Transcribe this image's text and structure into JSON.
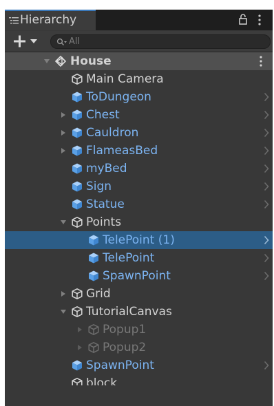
{
  "window": {
    "tab_label": "Hierarchy",
    "search_placeholder": "All"
  },
  "scene": {
    "name": "House"
  },
  "rows": [
    {
      "label": "Main Camera",
      "depth": 1,
      "type": "object",
      "fold": "none",
      "go_arrow": false,
      "selected": false,
      "disabled": false
    },
    {
      "label": "ToDungeon",
      "depth": 1,
      "type": "prefab",
      "fold": "none",
      "go_arrow": true,
      "selected": false,
      "disabled": false
    },
    {
      "label": "Chest",
      "depth": 1,
      "type": "prefab",
      "fold": "collapsed",
      "go_arrow": true,
      "selected": false,
      "disabled": false
    },
    {
      "label": "Cauldron",
      "depth": 1,
      "type": "prefab",
      "fold": "collapsed",
      "go_arrow": true,
      "selected": false,
      "disabled": false
    },
    {
      "label": "FlameasBed",
      "depth": 1,
      "type": "prefab",
      "fold": "collapsed",
      "go_arrow": true,
      "selected": false,
      "disabled": false
    },
    {
      "label": "myBed",
      "depth": 1,
      "type": "prefab",
      "fold": "none",
      "go_arrow": true,
      "selected": false,
      "disabled": false
    },
    {
      "label": "Sign",
      "depth": 1,
      "type": "prefab",
      "fold": "none",
      "go_arrow": true,
      "selected": false,
      "disabled": false
    },
    {
      "label": "Statue",
      "depth": 1,
      "type": "prefab",
      "fold": "none",
      "go_arrow": true,
      "selected": false,
      "disabled": false
    },
    {
      "label": "Points",
      "depth": 1,
      "type": "object",
      "fold": "expanded",
      "go_arrow": false,
      "selected": false,
      "disabled": false
    },
    {
      "label": "TelePoint (1)",
      "depth": 2,
      "type": "prefab",
      "fold": "none",
      "go_arrow": true,
      "selected": true,
      "disabled": false
    },
    {
      "label": "TelePoint",
      "depth": 2,
      "type": "prefab",
      "fold": "none",
      "go_arrow": true,
      "selected": false,
      "disabled": false
    },
    {
      "label": "SpawnPoint",
      "depth": 2,
      "type": "prefab",
      "fold": "none",
      "go_arrow": true,
      "selected": false,
      "disabled": false
    },
    {
      "label": "Grid",
      "depth": 1,
      "type": "object",
      "fold": "collapsed",
      "go_arrow": false,
      "selected": false,
      "disabled": false
    },
    {
      "label": "TutorialCanvas",
      "depth": 1,
      "type": "object",
      "fold": "expanded",
      "go_arrow": false,
      "selected": false,
      "disabled": false
    },
    {
      "label": "Popup1",
      "depth": 2,
      "type": "object",
      "fold": "collapsed",
      "go_arrow": false,
      "selected": false,
      "disabled": true
    },
    {
      "label": "Popup2",
      "depth": 2,
      "type": "object",
      "fold": "collapsed",
      "go_arrow": false,
      "selected": false,
      "disabled": true
    },
    {
      "label": "SpawnPoint",
      "depth": 1,
      "type": "prefab",
      "fold": "none",
      "go_arrow": true,
      "selected": false,
      "disabled": false
    },
    {
      "label": "block",
      "depth": 1,
      "type": "object",
      "fold": "none",
      "go_arrow": false,
      "selected": false,
      "disabled": false
    }
  ],
  "colors": {
    "panel": "#383838",
    "selection": "#2c5d87",
    "prefab_text": "#7cb4f2",
    "text": "#d2d2d2",
    "disabled_text": "#777777"
  }
}
